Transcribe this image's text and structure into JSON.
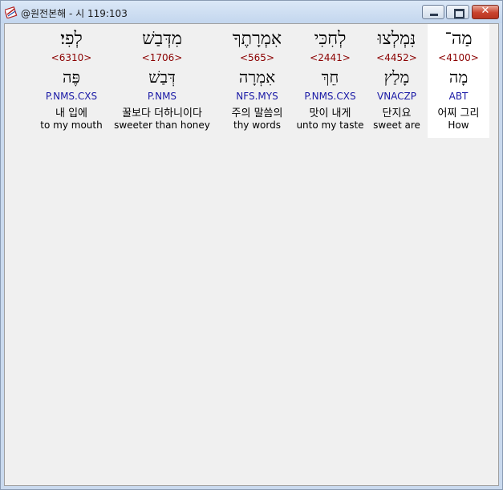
{
  "window": {
    "title": "@원전본해 - 시 119:103"
  },
  "words": [
    {
      "hebrew": "מַה־",
      "strongs": "<4100>",
      "lemma": "מָה",
      "morph": "ABT",
      "korean": "어찌 그리",
      "english": "How"
    },
    {
      "hebrew": "נִּמְלְצוּ",
      "strongs": "<4452>",
      "lemma": "מָלַץ",
      "morph": "VNACZP",
      "korean": "단지요",
      "english": "sweet are"
    },
    {
      "hebrew": "לְחִכִּי",
      "strongs": "<2441>",
      "lemma": "חֵךְ",
      "morph": "P.NMS.CXS",
      "korean": "맛이 내게",
      "english": "unto my taste"
    },
    {
      "hebrew": "אִמְרָתֶךָ",
      "strongs": "<565>",
      "lemma": "אִמְרָה",
      "morph": "NFS.MYS",
      "korean": "주의 말씀의",
      "english": "thy words"
    },
    {
      "hebrew": "מִדְּבַשׁ",
      "strongs": "<1706>",
      "lemma": "דְּבַשׁ",
      "morph": "P.NMS",
      "korean": "꿀보다 더하니이다",
      "english": "sweeter than honey"
    },
    {
      "hebrew": "לְפִי׃",
      "strongs": "<6310>",
      "lemma": "פֶּה",
      "morph": "P.NMS.CXS",
      "korean": "내 입에",
      "english": "to my mouth"
    }
  ],
  "colors": {
    "strongs": "#8b0000",
    "morph": "#1a1aa6",
    "highlight": "#ffffff"
  }
}
